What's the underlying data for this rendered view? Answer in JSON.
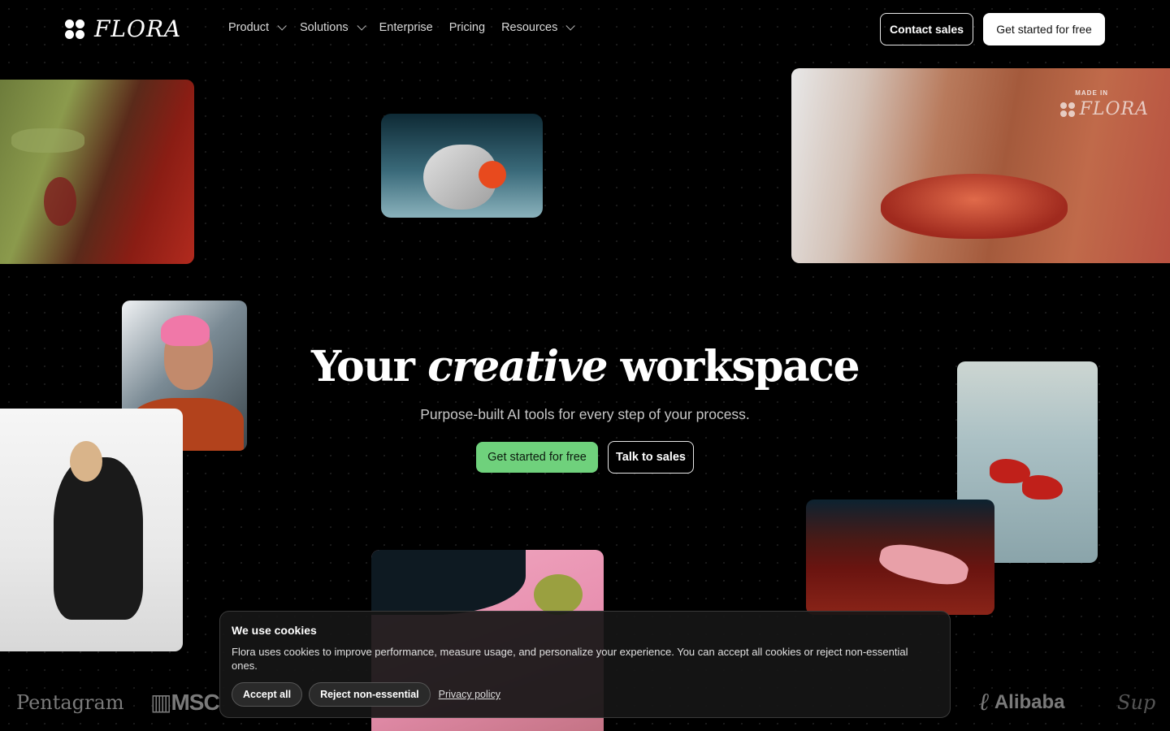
{
  "brand": {
    "wordmark": "FLORA",
    "watermark_prefix": "MADE IN",
    "watermark_word": "FLORA"
  },
  "nav": {
    "items": [
      {
        "label": "Product",
        "has_dropdown": true
      },
      {
        "label": "Solutions",
        "has_dropdown": true
      },
      {
        "label": "Enterprise",
        "has_dropdown": false
      },
      {
        "label": "Pricing",
        "has_dropdown": false
      },
      {
        "label": "Resources",
        "has_dropdown": true
      }
    ],
    "contact_label": "Contact sales",
    "get_started_label": "Get started for free"
  },
  "hero": {
    "title_before": "Your",
    "title_em": "creative",
    "title_after": "workspace",
    "subtitle": "Purpose-built AI tools for every step of your process.",
    "primary_cta": "Get started for free",
    "secondary_cta": "Talk to sales",
    "accent_color": "#6fd17c"
  },
  "logos": {
    "pentagram": "Pentagram",
    "msc": "MSC",
    "alibaba": "Alibaba",
    "partial": "Sup"
  },
  "cookie": {
    "title": "We use cookies",
    "body": "Flora uses cookies to improve performance, measure usage, and personalize your experience. You can accept all cookies or reject non-essential ones.",
    "accept_label": "Accept all",
    "reject_label": "Reject non-essential",
    "privacy_label": "Privacy policy"
  }
}
